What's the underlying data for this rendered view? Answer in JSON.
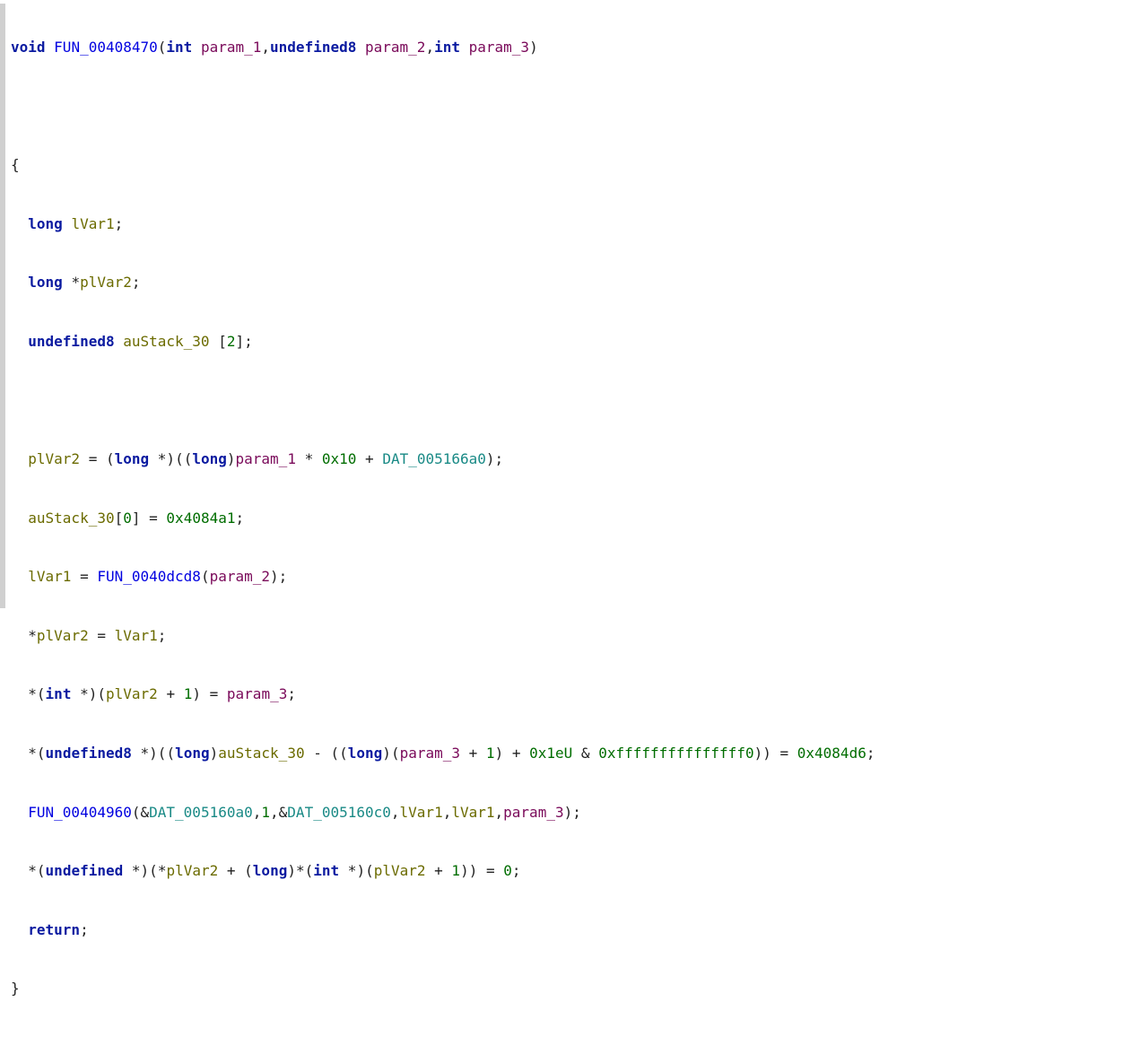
{
  "tokens": {
    "kw_void": "void",
    "kw_int": "int",
    "kw_long": "long",
    "kw_return": "return",
    "type_undefined8": "undefined8",
    "type_undefined": "undefined",
    "fn_main": "FUN_00408470",
    "fn_call1": "FUN_0040dcd8",
    "fn_call2": "FUN_00404960",
    "param_1": "param_1",
    "param_2": "param_2",
    "param_3": "param_3",
    "lvar1": "lVar1",
    "plvar2": "plVar2",
    "austack": "auStack_30",
    "dat1": "DAT_005166a0",
    "dat2": "DAT_005160a0",
    "dat3": "DAT_005160c0",
    "num_2": "2",
    "num_0x10": "0x10",
    "num_0x4084a1": "0x4084a1",
    "num_0": "0",
    "num_1": "1",
    "num_0x1eU": "0x1eU",
    "num_mask": "0xfffffffffffffff0",
    "num_0x4084d6": "0x4084d6"
  },
  "punct": {
    "open_paren": "(",
    "close_paren": ")",
    "open_brace": "{",
    "close_brace": "}",
    "open_bracket": "[",
    "close_bracket": "]",
    "semicolon": ";",
    "comma": ",",
    "star": "*",
    "space": " ",
    "eq_sp": " = ",
    "plus_sp": " + ",
    "amp": "&",
    "amp_sp": " & ",
    "minus_sp": " - "
  }
}
